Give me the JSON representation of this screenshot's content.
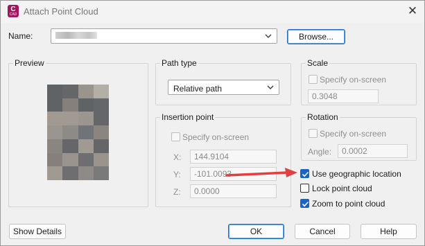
{
  "window": {
    "title": "Attach Point Cloud",
    "icon": "autocad-logo-icon",
    "icon_letter": "C",
    "icon_sub": "CAD"
  },
  "name_row": {
    "label": "Name:",
    "browse_label": "Browse..."
  },
  "preview": {
    "label": "Preview"
  },
  "path_type": {
    "label": "Path type",
    "selected": "Relative path"
  },
  "insertion_point": {
    "label": "Insertion point",
    "specify_label": "Specify on-screen",
    "x_label": "X:",
    "x_value": "144.9104",
    "y_label": "Y:",
    "y_value": "-101.0093",
    "z_label": "Z:",
    "z_value": "0.0000"
  },
  "scale": {
    "label": "Scale",
    "specify_label": "Specify on-screen",
    "value": "0.3048"
  },
  "rotation": {
    "label": "Rotation",
    "specify_label": "Specify on-screen",
    "angle_label": "Angle:",
    "angle_value": "0.0002"
  },
  "options": {
    "geo_label": "Use geographic location",
    "geo_checked": true,
    "lock_label": "Lock point cloud",
    "lock_checked": false,
    "zoom_label": "Zoom to point cloud",
    "zoom_checked": true
  },
  "buttons": {
    "show_details": "Show Details",
    "ok": "OK",
    "cancel": "Cancel",
    "help": "Help"
  },
  "colors": {
    "accent": "#1a64c8",
    "annotation_arrow": "#e04040",
    "icon_bg": "#a3155e"
  }
}
